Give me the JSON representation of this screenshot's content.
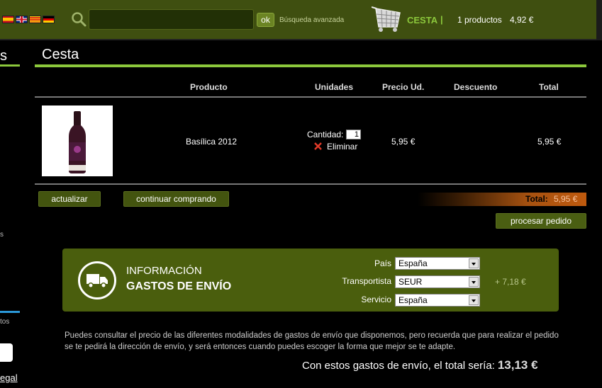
{
  "header": {
    "search_placeholder": "",
    "ok_label": "ok",
    "advanced_search": "Búsqueda avanzada",
    "cart_label": "CESTA",
    "cart_separator": "|",
    "cart_count": "1 productos",
    "cart_total": "4,92 €",
    "flags": [
      "spanish-flag-icon",
      "uk-flag-icon",
      "catalan-flag-icon",
      "german-flag-icon"
    ]
  },
  "sidebar": {
    "heading_fragment": "s",
    "item_fragment": "s",
    "text_fragment": "tos",
    "legal_fragment": "egal"
  },
  "main": {
    "title": "Cesta",
    "columns": [
      "Producto",
      "Unidades",
      "Precio Ud.",
      "Descuento",
      "Total"
    ],
    "items": [
      {
        "name": "Basílica 2012",
        "quantity_label": "Cantidad:",
        "quantity": "1",
        "remove_label": "Eliminar",
        "unit_price": "5,95 €",
        "discount": "",
        "total": "5,95 €"
      }
    ],
    "update_button": "actualizar",
    "continue_button": "continuar comprando",
    "total_label": "Total:",
    "total_value": "5,95 €",
    "checkout_button": "procesar pedido"
  },
  "shipping": {
    "title_line1": "INFORMACIÓN",
    "title_line2": "GASTOS DE ENVÍO",
    "country_label": "País",
    "country_value": "España",
    "carrier_label": "Transportista",
    "carrier_value": "SEUR",
    "service_label": "Servicio",
    "service_value": "España",
    "cost": "+ 7,18 €",
    "info_text": "Puedes consultar el precio de las diferentes modalidades de gastos de envío que disponemos, pero recuerda que para realizar el pedido se te pedirá la dirección de envío, y será entonces cuando puedes escoger la forma que mejor se te adapte.",
    "final_label": "Con estos gastos de envío, el total sería:",
    "final_value": "13,13 €"
  },
  "colors": {
    "header_bg": "#3f4f10",
    "accent_green": "#8cc83c",
    "button_green": "#43540f",
    "shipping_box": "#4a5e0d",
    "total_orange": "#bf5a0e"
  }
}
